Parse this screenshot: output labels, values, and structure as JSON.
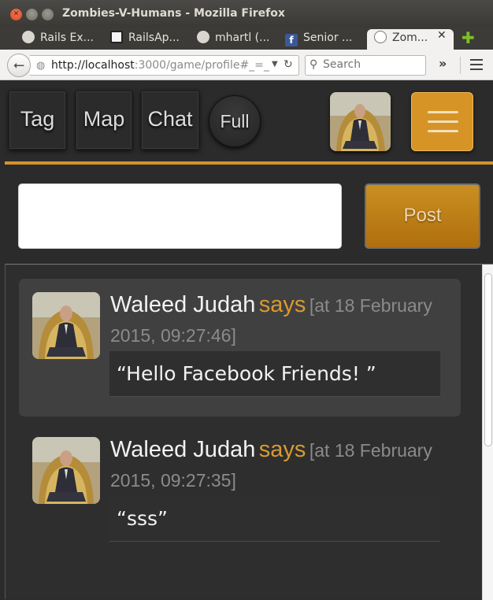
{
  "window": {
    "title": "Zombies-V-Humans - Mozilla Firefox"
  },
  "tabs": [
    {
      "label": "Rails Ex...",
      "icon": "github-icon"
    },
    {
      "label": "RailsAp...",
      "icon": "page-icon"
    },
    {
      "label": "mhartl (...",
      "icon": "github-icon"
    },
    {
      "label": "Senior ...",
      "icon": "facebook-icon"
    },
    {
      "label": "Zom...",
      "icon": "zombie-icon",
      "active": true
    }
  ],
  "navbar": {
    "url_host": "http://localhost",
    "url_rest": ":3000/game/profile#_=_",
    "search_placeholder": "Search"
  },
  "app_nav": {
    "tag": "Tag",
    "map": "Map",
    "chat": "Chat",
    "full": "Full"
  },
  "composer": {
    "post_label": "Post"
  },
  "posts": [
    {
      "name": "Waleed Judah",
      "says": "says",
      "time": "[at 18 February 2015, 09:27:46]",
      "message": "“Hello Facebook Friends! ”"
    },
    {
      "name": "Waleed Judah",
      "says": "says",
      "time": "[at 18 February 2015, 09:27:35]",
      "message": "“sss”"
    }
  ],
  "colors": {
    "accent": "#d69427",
    "background": "#2b2b2b",
    "says": "#d99a2f"
  }
}
